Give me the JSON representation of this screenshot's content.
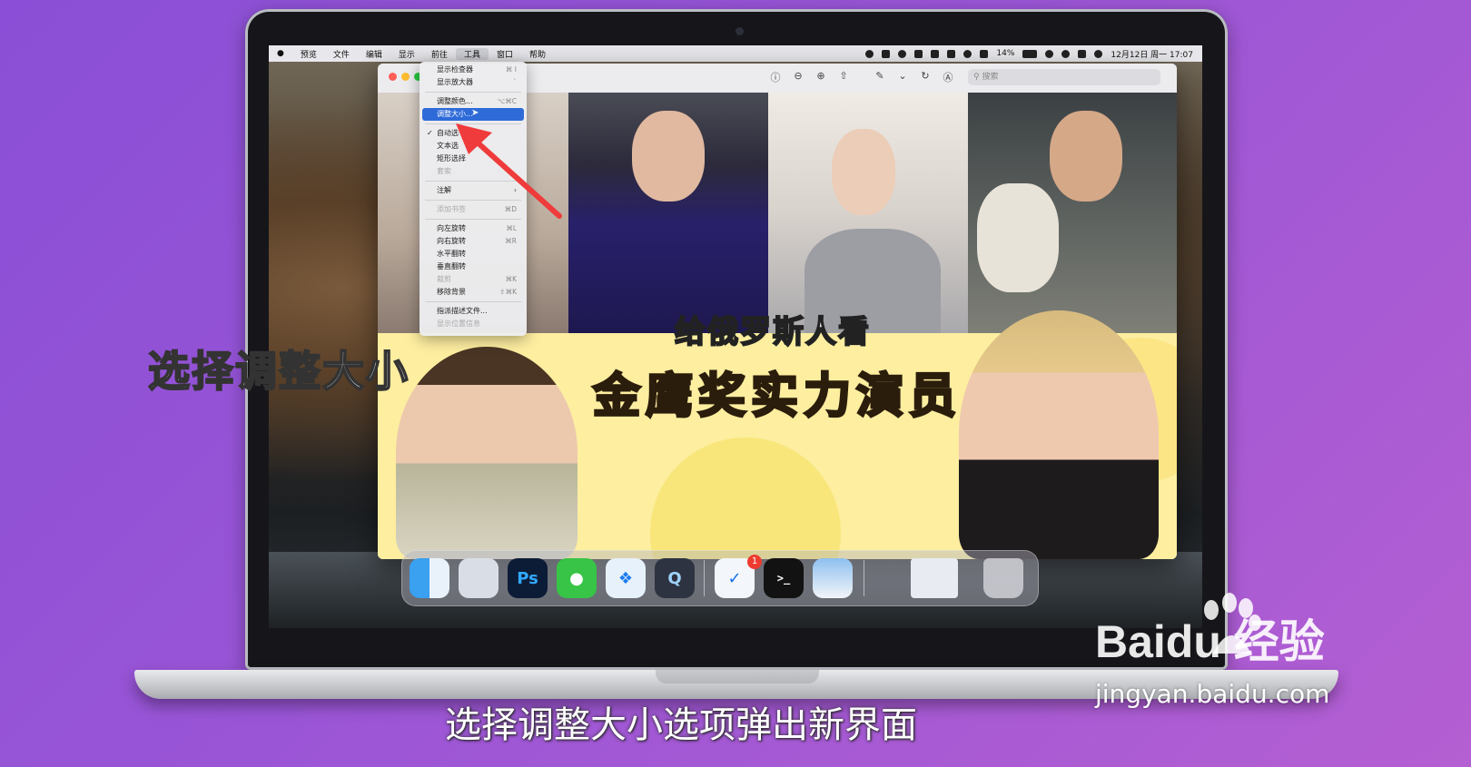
{
  "menubar": {
    "apple": "",
    "items": [
      "预览",
      "文件",
      "编辑",
      "显示",
      "前往",
      "工具",
      "窗口",
      "帮助"
    ],
    "active_index": 5,
    "battery": "14%",
    "datetime": "12月12日 周一  17:07"
  },
  "window": {
    "search_placeholder": "搜索"
  },
  "dropdown": {
    "items": [
      {
        "label": "显示检查器",
        "shortcut": "⌘ I",
        "disabled": false
      },
      {
        "label": "显示放大器",
        "shortcut": "`",
        "disabled": false
      },
      {
        "sep": true
      },
      {
        "label": "调整颜色...",
        "shortcut": "⌥⌘C",
        "disabled": false
      },
      {
        "label": "调整大小...",
        "shortcut": "",
        "disabled": false,
        "selected": true
      },
      {
        "sep": true
      },
      {
        "label": "自动选",
        "shortcut": "",
        "disabled": false,
        "checked": true
      },
      {
        "label": "文本选",
        "shortcut": "",
        "disabled": false
      },
      {
        "label": "矩形选择",
        "shortcut": "",
        "disabled": false
      },
      {
        "label": "套索",
        "shortcut": "",
        "disabled": true
      },
      {
        "sep": true
      },
      {
        "label": "注解",
        "shortcut": "›",
        "disabled": false
      },
      {
        "sep": true
      },
      {
        "label": "添加书签",
        "shortcut": "⌘D",
        "disabled": true
      },
      {
        "sep": true
      },
      {
        "label": "向左旋转",
        "shortcut": "⌘L",
        "disabled": false
      },
      {
        "label": "向右旋转",
        "shortcut": "⌘R",
        "disabled": false
      },
      {
        "label": "水平翻转",
        "shortcut": "",
        "disabled": false
      },
      {
        "label": "垂直翻转",
        "shortcut": "",
        "disabled": false
      },
      {
        "label": "裁剪",
        "shortcut": "⌘K",
        "disabled": true
      },
      {
        "label": "移除背景",
        "shortcut": "⇧⌘K",
        "disabled": false
      },
      {
        "sep": true
      },
      {
        "label": "指派描述文件...",
        "shortcut": "",
        "disabled": false
      },
      {
        "label": "显示位置信息",
        "shortcut": "",
        "disabled": true
      }
    ]
  },
  "thumbnail": {
    "headline_top": "给俄罗斯人看",
    "headline_main": "金鹰奖实力演员"
  },
  "dock": {
    "badge": "1",
    "apps": [
      "finder-icon",
      "launchpad-icon",
      "photoshop-icon",
      "messages-icon",
      "safari-icon",
      "quicktime-icon",
      "mail-client-icon",
      "terminal-icon",
      "preview-icon",
      "downloads-stack-icon",
      "trash-icon"
    ],
    "ps_label": "Ps",
    "terminal_label": ">_"
  },
  "captions": {
    "side": "选择调整大小",
    "bottom": "选择调整大小选项弹出新界面"
  },
  "watermark": {
    "logo": "Baidu 经验",
    "url": "jingyan.baidu.com"
  },
  "colors": {
    "selection": "#2f6bd8",
    "background": "#9a55d6",
    "headline": "#f6b81a"
  }
}
